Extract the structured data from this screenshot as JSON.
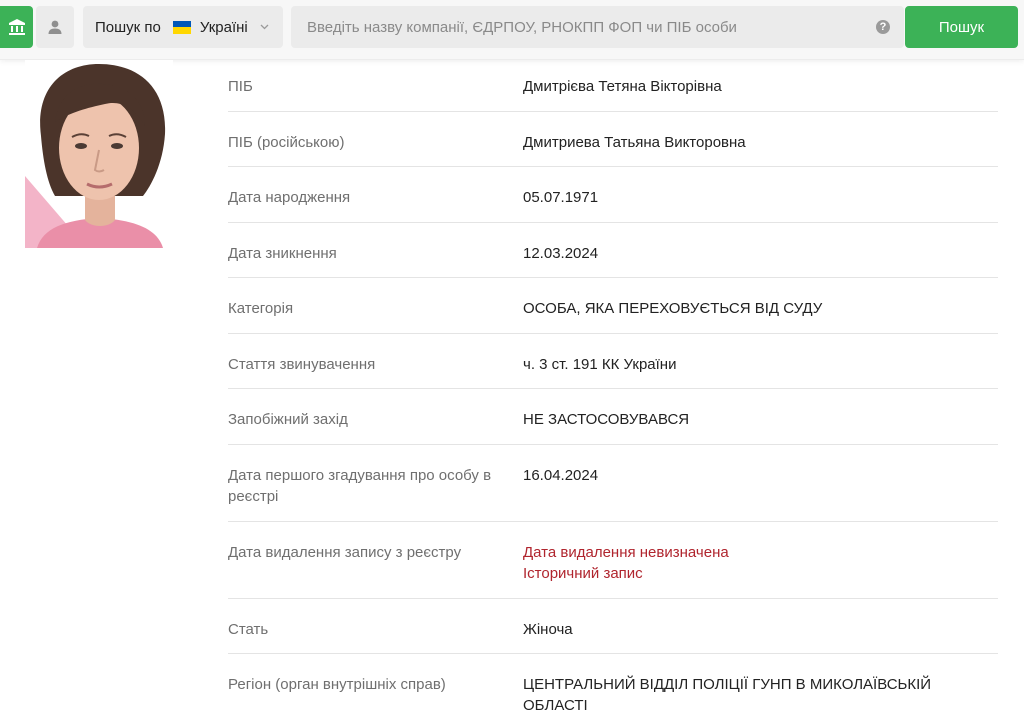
{
  "header": {
    "scope_prefix": "Пошук по",
    "scope_country": "Україні",
    "search_placeholder": "Введіть назву компанії, ЄДРПОУ, РНОКПП ФОП чи ПІБ особи",
    "search_button": "Пошук",
    "help_glyph": "?",
    "flag_colors": [
      "#0057b8",
      "#ffd700"
    ],
    "accent_color": "#3cb257"
  },
  "person": {
    "rows": [
      {
        "label": "ПІБ",
        "value": "Дмитрієва Тетяна Вікторівна"
      },
      {
        "label": "ПІБ (російською)",
        "value": "Дмитриева Татьяна Викторовна"
      },
      {
        "label": "Дата народження",
        "value": "05.07.1971"
      },
      {
        "label": "Дата зникнення",
        "value": "12.03.2024"
      },
      {
        "label": "Категорія",
        "value": "ОСОБА, ЯКА ПЕРЕХОВУЄТЬСЯ ВІД СУДУ"
      },
      {
        "label": "Стаття звинувачення",
        "value": "ч. 3 ст. 191 КК України"
      },
      {
        "label": "Запобіжний захід",
        "value": "НЕ ЗАСТОСОВУВАВСЯ"
      },
      {
        "label": "Дата першого згадування про особу в реєстрі",
        "value": "16.04.2024"
      },
      {
        "label": "Дата видалення запису з реєстру",
        "value_line1": "Дата видалення невизначена",
        "value_line2": "Історичний запис"
      },
      {
        "label": "Стать",
        "value": "Жіноча"
      },
      {
        "label": "Регіон (орган внутрішніх справ)",
        "value": "ЦЕНТРАЛЬНИЙ ВІДДІЛ ПОЛІЦІЇ ГУНП В МИКОЛАЇВСЬКІЙ ОБЛАСТІ"
      }
    ],
    "warning_color": "#b0252e"
  },
  "icons": {
    "company_tab": "bank-building-icon",
    "person_tab": "person-icon",
    "scope_dropdown": "chevron-down-icon",
    "help": "question-circle-icon"
  }
}
